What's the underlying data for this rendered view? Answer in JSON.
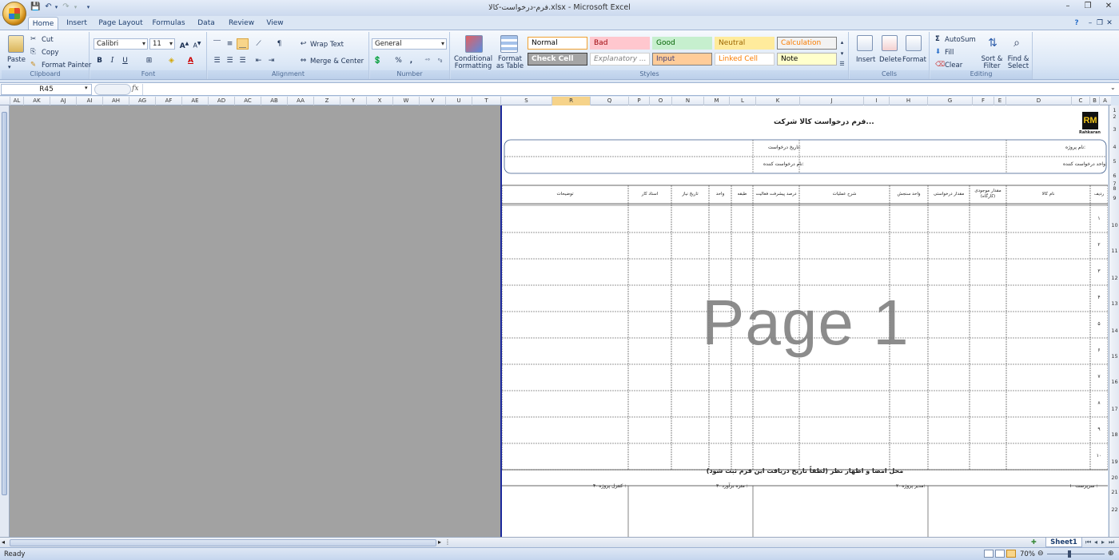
{
  "window": {
    "title": "فرم-درخواست-کالا.xlsx - Microsoft Excel",
    "help_icon": "help-icon",
    "minimize": "–",
    "restore": "❐",
    "close": "✕"
  },
  "tabs": [
    "Home",
    "Insert",
    "Page Layout",
    "Formulas",
    "Data",
    "Review",
    "View"
  ],
  "ribbon": {
    "clipboard": {
      "label": "Clipboard",
      "paste": "Paste",
      "cut": "Cut",
      "copy": "Copy",
      "format_painter": "Format Painter"
    },
    "font": {
      "label": "Font",
      "name": "Calibri",
      "size": "11",
      "bold": "B",
      "italic": "I",
      "underline": "U"
    },
    "alignment": {
      "label": "Alignment",
      "wrap": "Wrap Text",
      "merge": "Merge & Center"
    },
    "number": {
      "label": "Number",
      "format": "General",
      "percent": "%",
      "comma": ","
    },
    "styles": {
      "label": "Styles",
      "conditional": "Conditional Formatting",
      "format_table": "Format as Table",
      "cells": [
        {
          "name": "Normal",
          "bg": "#ffffff",
          "fg": "#000000",
          "border": "#f0a030"
        },
        {
          "name": "Bad",
          "bg": "#ffc7ce",
          "fg": "#9c0006",
          "border": "#ffc7ce"
        },
        {
          "name": "Good",
          "bg": "#c6efce",
          "fg": "#006100",
          "border": "#c6efce"
        },
        {
          "name": "Neutral",
          "bg": "#ffeb9c",
          "fg": "#9c6500",
          "border": "#ffeb9c"
        },
        {
          "name": "Calculation",
          "bg": "#f2f2f2",
          "fg": "#fa7d00",
          "border": "#7f7f7f"
        },
        {
          "name": "Check Cell",
          "bg": "#a5a5a5",
          "fg": "#ffffff",
          "border": "#3f3f3f"
        },
        {
          "name": "Explanatory ...",
          "bg": "#ffffff",
          "fg": "#7f7f7f",
          "border": "#d0d0d0"
        },
        {
          "name": "Input",
          "bg": "#ffcc99",
          "fg": "#3f3f76",
          "border": "#7f7f7f"
        },
        {
          "name": "Linked Cell",
          "bg": "#ffffff",
          "fg": "#fa7d00",
          "border": "#d0d0d0"
        },
        {
          "name": "Note",
          "bg": "#ffffcc",
          "fg": "#000000",
          "border": "#b2b2b2"
        }
      ]
    },
    "cells": {
      "label": "Cells",
      "insert": "Insert",
      "delete": "Delete",
      "format": "Format"
    },
    "editing": {
      "label": "Editing",
      "autosum": "AutoSum",
      "fill": "Fill",
      "clear": "Clear",
      "sort": "Sort & Filter",
      "find": "Find & Select"
    }
  },
  "formula_bar": {
    "name_box": "R45",
    "fx": "fx",
    "value": ""
  },
  "columns": [
    "AL",
    "AK",
    "AJ",
    "AI",
    "AH",
    "AG",
    "AF",
    "AE",
    "AD",
    "AC",
    "AB",
    "AA",
    "Z",
    "Y",
    "X",
    "W",
    "V",
    "U",
    "T",
    "S",
    "R",
    "Q",
    "P",
    "O",
    "N",
    "M",
    "L",
    "K",
    "J",
    "I",
    "H",
    "G",
    "F",
    "E",
    "D",
    "C",
    "B",
    "A"
  ],
  "selected_column": "R",
  "rows": [
    "1",
    "2",
    "3",
    "4",
    "5",
    "6",
    "7",
    "8",
    "9",
    "10",
    "11",
    "12",
    "13",
    "14",
    "15",
    "16",
    "17",
    "18",
    "19",
    "20",
    "21",
    "22"
  ],
  "sheet": {
    "logo_text": "RM",
    "logo_sub": "Rahkaran",
    "form_title": "فرم درخواست کالا شرکت...",
    "project_name": "نام پروژه:",
    "request_date": "تاریخ درخواست:",
    "request_unit": "واحد درخواست کننده:",
    "requester_name": "نام درخواست کننده:",
    "headers": [
      "ردیف",
      "نام کالا",
      "مقدار موجودی (کارگاه)",
      "مقدار درخواستی",
      "واحد سنجش",
      "شرح عملیات",
      "درصد پیشرفت فعالیت",
      "طبقه",
      "واحد",
      "تاریخ نیاز",
      "استاد کار",
      "توضیحات"
    ],
    "row_numbers": [
      "۱",
      "۲",
      "۳",
      "۴",
      "۵",
      "۶",
      "۷",
      "۸",
      "۹",
      "۱۰"
    ],
    "signature_title": "محل امضا و اظهار نظر (لطفاً تاریخ دریافت این فرم ثبت شود)",
    "signers": [
      "۱- سرپرست :",
      "۲- مدیر پروژه:",
      "۳- متره برآورد :",
      "۴- کنترل پروژه :"
    ],
    "watermark": "Page 1"
  },
  "sheet_tab": "Sheet1",
  "status": {
    "ready": "Ready",
    "zoom": "70%"
  }
}
